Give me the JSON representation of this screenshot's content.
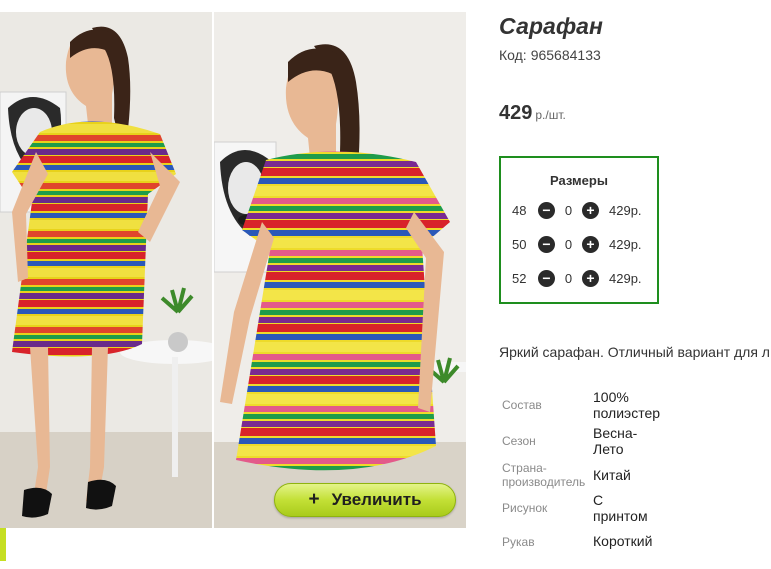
{
  "product": {
    "title": "Сарафан",
    "code_label": "Код:",
    "code": "965684133",
    "price": "429",
    "price_unit": "р./шт."
  },
  "sizes": {
    "title": "Размеры",
    "rows": [
      {
        "size": "48",
        "qty": "0",
        "price": "429р."
      },
      {
        "size": "50",
        "qty": "0",
        "price": "429р."
      },
      {
        "size": "52",
        "qty": "0",
        "price": "429р."
      }
    ]
  },
  "gallery": {
    "zoom_label": "Увеличить",
    "zoom_icon": "plus"
  },
  "description": "Яркий сарафан. Отличный вариант для л",
  "properties": [
    {
      "label": "Состав",
      "value": [
        "100%",
        "полиэстер"
      ]
    },
    {
      "label": "Сезон",
      "value": [
        "Весна-",
        "Лето"
      ]
    },
    {
      "label": [
        "Страна-",
        "производитель"
      ],
      "value": [
        "Китай"
      ]
    },
    {
      "label": "Рисунок",
      "value": [
        "С",
        "принтом"
      ]
    },
    {
      "label": "Рукав",
      "value": [
        "Короткий"
      ]
    }
  ],
  "colors": {
    "sizes_border": "#1e8e1e",
    "zoom_button": "#c3e036",
    "accent_strip": "#c6df22"
  }
}
